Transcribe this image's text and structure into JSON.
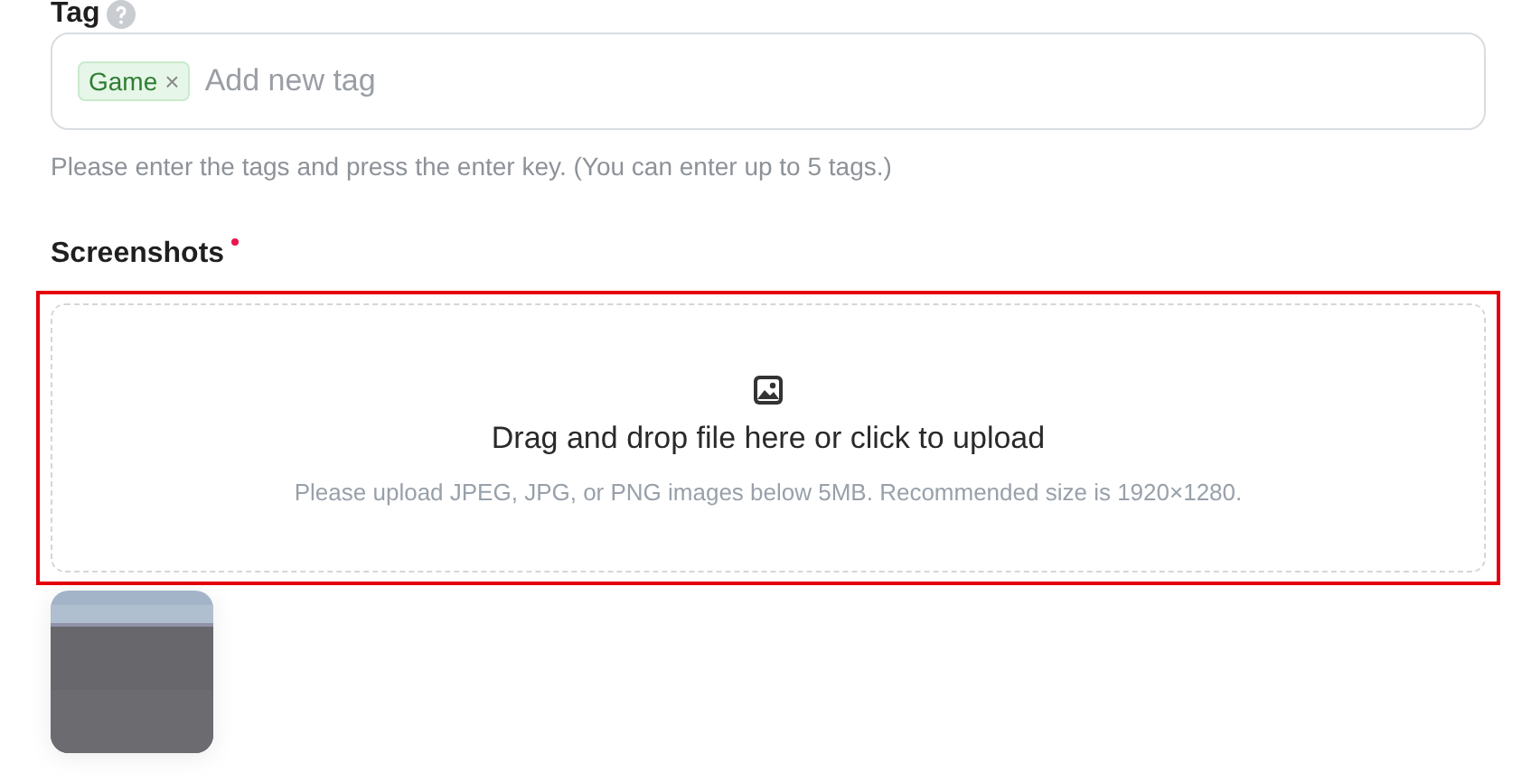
{
  "tag_field": {
    "label": "Tag",
    "tags": [
      {
        "label": "Game",
        "remove": "×"
      }
    ],
    "placeholder": "Add new tag",
    "hint": "Please enter the tags and press the enter key. (You can enter up to 5 tags.)"
  },
  "screenshots": {
    "label": "Screenshots",
    "required": true,
    "error": true,
    "title": "Drag and drop file here or click to upload",
    "hint": "Please upload JPEG, JPG, or PNG images below 5MB. Recommended size is 1920×1280."
  }
}
